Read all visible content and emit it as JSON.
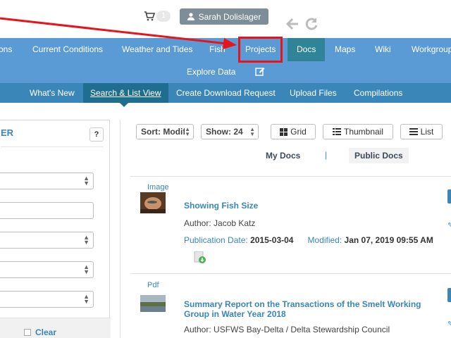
{
  "header": {
    "cart_count": "1",
    "user_name": "Sarah Dolislager"
  },
  "main_nav": {
    "items": [
      {
        "label": "ons"
      },
      {
        "label": "Current Conditions"
      },
      {
        "label": "Weather and Tides"
      },
      {
        "label": "Fish"
      },
      {
        "label": "Projects"
      },
      {
        "label": "Docs"
      },
      {
        "label": "Maps"
      },
      {
        "label": "Wiki"
      },
      {
        "label": "Workgroup"
      }
    ],
    "explore_label": "Explore Data"
  },
  "sub_nav": {
    "items": [
      {
        "label": "What's New"
      },
      {
        "label": "Search & List View"
      },
      {
        "label": "Create Download Request"
      },
      {
        "label": "Upload Files"
      },
      {
        "label": "Compilations"
      }
    ]
  },
  "filter_panel": {
    "title": "ER",
    "help_label": "?",
    "clear_label": "Clear"
  },
  "results": {
    "sort_label": "Sort: Modifi",
    "show_label": "Show: 24",
    "view_buttons": [
      "Grid",
      "Thumbnail",
      "List"
    ],
    "my_docs_label": "My Docs",
    "separator": "|",
    "public_docs_label": "Public Docs",
    "cards": [
      {
        "type": "Image",
        "title": "Showing Fish Size",
        "author": "Author: Jacob Katz",
        "pub_label": "Publication Date:",
        "pub_date": "2015-03-04",
        "mod_label": "Modified:",
        "mod_date": "Jan 07, 2019 09:55 AM"
      },
      {
        "type": "Pdf",
        "title": "Summary Report on the Transactions of the Smelt Working Group in Water Year 2018",
        "author": "Author: USFWS Bay-Delta / Delta Stewardship Council"
      }
    ]
  },
  "colors": {
    "nav_blue": "#5b9bd5",
    "subnav_blue": "#3a86b8",
    "active_teal": "#2f8497",
    "annotation_red": "#e8141b"
  }
}
